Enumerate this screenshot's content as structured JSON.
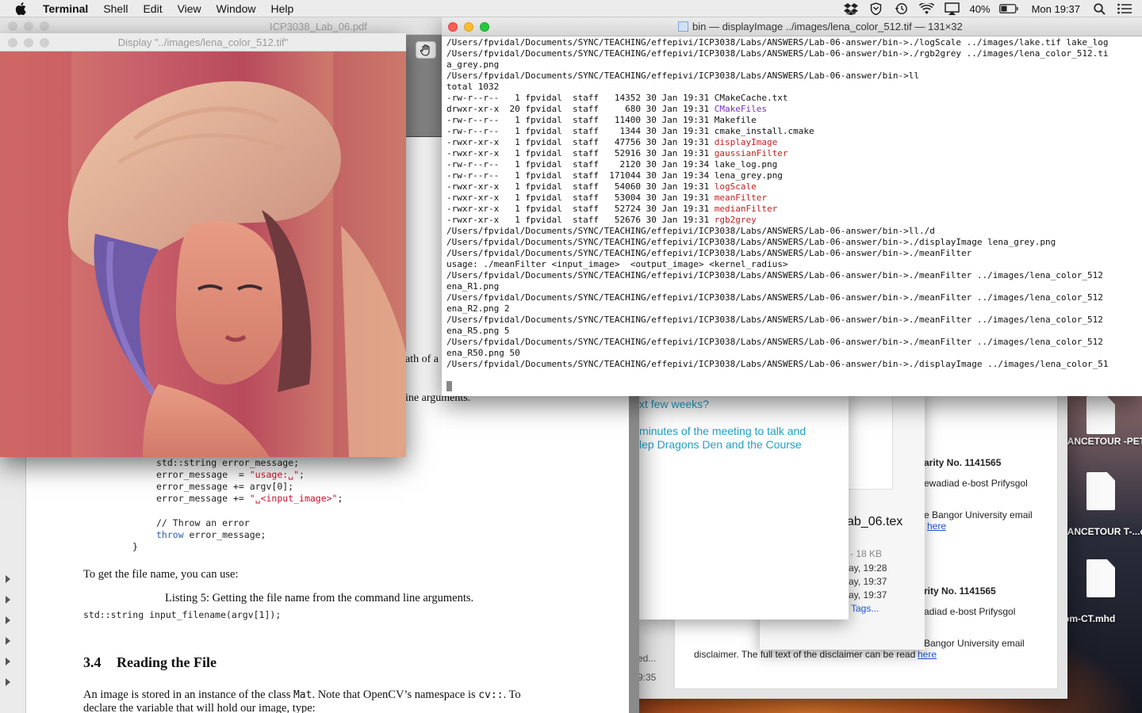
{
  "menubar": {
    "app": "Terminal",
    "items": [
      "Shell",
      "Edit",
      "View",
      "Window",
      "Help"
    ],
    "battery": "40%",
    "clock": "Mon 19:37"
  },
  "desktop": {
    "icons": [
      "RANCETOUR -PET.mha",
      "RANCETOUR T-...cted.mha",
      "tom-CT.mhd"
    ]
  },
  "pdf": {
    "title": "ICP3038_Lab_06.pdf",
    "frag_path": "ath of a",
    "frag_args": "ine arguments.",
    "code1": [
      {
        "p1": "std::string error_message;",
        "s": "",
        "p2": ""
      },
      {
        "p1": "error_message  = ",
        "s": "\"usage:␣\"",
        "p2": ";"
      },
      {
        "p1": "error_message += argv[0];",
        "s": "",
        "p2": ""
      },
      {
        "p1": "error_message += ",
        "s": "\"␣<input_image>\"",
        "p2": ";"
      }
    ],
    "comment": "// Throw an error",
    "throw_kw": "throw",
    "throw_rest": " error_message;",
    "brace": "}",
    "para1": "To get the file name, you can use:",
    "listing": "Listing 5: Getting the file name from the command line arguments.",
    "code2": "std::string input_filename(argv[1]);",
    "section_num": "3.4",
    "section_title": "Reading the File",
    "para2_a": "An image is stored in an instance of the class ",
    "para2_mat": "Mat",
    "para2_b": ".  Note that OpenCV’s namespace is ",
    "para2_cv": "cv::",
    "para2_c": ".  To",
    "para3": "declare the variable that will hold our image, type:"
  },
  "image_window": {
    "title": "Display \"../images/lena_color_512.tif\""
  },
  "mail": {
    "charity1": "arity No. 1141565",
    "welsh1": "ewadiad e-bost Prifysgol",
    "bangor1": "e Bangor University email",
    "here1": "here",
    "charity2": "rity No. 1141565",
    "welsh2": "adiad e-bost Prifysgol",
    "bangor2": "Bangor University email",
    "disclaimer": "disclaimer. The full text of the disclaimer can be read ",
    "here2": "here",
    "left_frag1": "ed...",
    "left_frag2": "9:35"
  },
  "finder": {
    "filename": "ab_06.tex",
    "size": "- 18 KB",
    "date1": "ay, 19:28",
    "date2": "ay, 19:37",
    "date3": "ay, 19:37",
    "tags": "Tags..."
  },
  "note": {
    "line1": "xt few weeks?",
    "line2": "minutes of the meeting to talk and",
    "line3": "lep Dragons Den and the Course"
  },
  "terminal": {
    "title": "bin — displayImage ../images/lena_color_512.tif — 131×32",
    "lines": [
      [
        {
          "t": "/Users/fpvidal/Documents/SYNC/TEACHING/effepivi/ICP3038/Labs/ANSWERS/Lab-06-answer/bin->./logScale ../images/lake.tif lake_log"
        }
      ],
      [
        {
          "t": "/Users/fpvidal/Documents/SYNC/TEACHING/effepivi/ICP3038/Labs/ANSWERS/Lab-06-answer/bin->./rgb2grey ../images/lena_color_512.ti"
        }
      ],
      [
        {
          "t": "a_grey.png"
        }
      ],
      [
        {
          "t": "/Users/fpvidal/Documents/SYNC/TEACHING/effepivi/ICP3038/Labs/ANSWERS/Lab-06-answer/bin->ll"
        }
      ],
      [
        {
          "t": "total 1032"
        }
      ],
      [
        {
          "t": "-rw-r--r--   1 fpvidal  staff   14352 30 Jan 19:31 CMakeCache.txt"
        }
      ],
      [
        {
          "t": "drwxr-xr-x  20 fpvidal  staff     680 30 Jan 19:31 "
        },
        {
          "t": "CMakeFiles",
          "c": "purple"
        }
      ],
      [
        {
          "t": "-rw-r--r--   1 fpvidal  staff   11400 30 Jan 19:31 Makefile"
        }
      ],
      [
        {
          "t": "-rw-r--r--   1 fpvidal  staff    1344 30 Jan 19:31 cmake_install.cmake"
        }
      ],
      [
        {
          "t": "-rwxr-xr-x   1 fpvidal  staff   47756 30 Jan 19:31 "
        },
        {
          "t": "displayImage",
          "c": "red"
        }
      ],
      [
        {
          "t": "-rwxr-xr-x   1 fpvidal  staff   52916 30 Jan 19:31 "
        },
        {
          "t": "gaussianFilter",
          "c": "red"
        }
      ],
      [
        {
          "t": "-rw-r--r--   1 fpvidal  staff    2120 30 Jan 19:34 lake_log.png"
        }
      ],
      [
        {
          "t": "-rw-r--r--   1 fpvidal  staff  171044 30 Jan 19:34 lena_grey.png"
        }
      ],
      [
        {
          "t": "-rwxr-xr-x   1 fpvidal  staff   54060 30 Jan 19:31 "
        },
        {
          "t": "logScale",
          "c": "red"
        }
      ],
      [
        {
          "t": "-rwxr-xr-x   1 fpvidal  staff   53004 30 Jan 19:31 "
        },
        {
          "t": "meanFilter",
          "c": "red"
        }
      ],
      [
        {
          "t": "-rwxr-xr-x   1 fpvidal  staff   52724 30 Jan 19:31 "
        },
        {
          "t": "medianFilter",
          "c": "red"
        }
      ],
      [
        {
          "t": "-rwxr-xr-x   1 fpvidal  staff   52676 30 Jan 19:31 "
        },
        {
          "t": "rgb2grey",
          "c": "red"
        }
      ],
      [
        {
          "t": "/Users/fpvidal/Documents/SYNC/TEACHING/effepivi/ICP3038/Labs/ANSWERS/Lab-06-answer/bin->ll./d"
        }
      ],
      [
        {
          "t": "/Users/fpvidal/Documents/SYNC/TEACHING/effepivi/ICP3038/Labs/ANSWERS/Lab-06-answer/bin->./displayImage lena_grey.png"
        }
      ],
      [
        {
          "t": "/Users/fpvidal/Documents/SYNC/TEACHING/effepivi/ICP3038/Labs/ANSWERS/Lab-06-answer/bin->./meanFilter"
        }
      ],
      [
        {
          "t": "usage: ./meanFilter <input_image>  <output_image> <kernel_radius>"
        }
      ],
      [
        {
          "t": "/Users/fpvidal/Documents/SYNC/TEACHING/effepivi/ICP3038/Labs/ANSWERS/Lab-06-answer/bin->./meanFilter ../images/lena_color_512"
        }
      ],
      [
        {
          "t": "ena_R1.png"
        }
      ],
      [
        {
          "t": "/Users/fpvidal/Documents/SYNC/TEACHING/effepivi/ICP3038/Labs/ANSWERS/Lab-06-answer/bin->./meanFilter ../images/lena_color_512"
        }
      ],
      [
        {
          "t": "ena_R2.png 2"
        }
      ],
      [
        {
          "t": "/Users/fpvidal/Documents/SYNC/TEACHING/effepivi/ICP3038/Labs/ANSWERS/Lab-06-answer/bin->./meanFilter ../images/lena_color_512"
        }
      ],
      [
        {
          "t": "ena_R5.png 5"
        }
      ],
      [
        {
          "t": "/Users/fpvidal/Documents/SYNC/TEACHING/effepivi/ICP3038/Labs/ANSWERS/Lab-06-answer/bin->./meanFilter ../images/lena_color_512"
        }
      ],
      [
        {
          "t": "ena_R50.png 50"
        }
      ],
      [
        {
          "t": "/Users/fpvidal/Documents/SYNC/TEACHING/effepivi/ICP3038/Labs/ANSWERS/Lab-06-answer/bin->./displayImage ../images/lena_color_51"
        }
      ]
    ]
  },
  "colors": {
    "close": "#fc5f57",
    "minimize": "#fdbc2e",
    "maximize": "#28c840",
    "inactive_dot": "#d0d0d0",
    "term_red": "#c22020",
    "term_purple": "#7a2bc8",
    "note_cyan": "#1fa1c8",
    "link_blue": "#1a55d8"
  },
  "icons": [
    "apple-icon",
    "dropbox-icon",
    "shield-icon",
    "time-machine-icon",
    "wifi-icon",
    "airplay-icon",
    "battery-icon",
    "search-icon",
    "list-icon",
    "hand-tool-icon",
    "document-icon"
  ]
}
